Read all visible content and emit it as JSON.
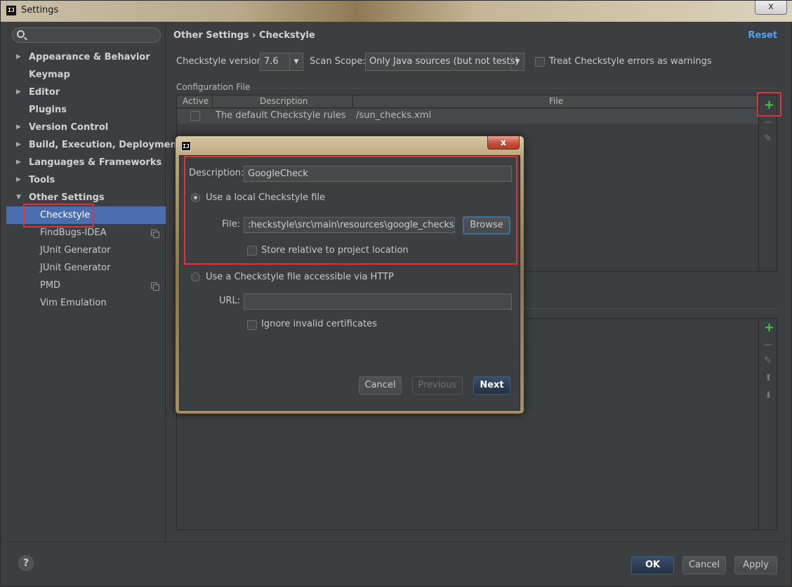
{
  "window": {
    "title": "Settings",
    "app_icon": "IJ",
    "close": "x"
  },
  "sidebar": {
    "search": {
      "placeholder": "",
      "value": ""
    },
    "items": [
      {
        "label": "Appearance & Behavior",
        "arrow": "▶"
      },
      {
        "label": "Keymap",
        "arrow": ""
      },
      {
        "label": "Editor",
        "arrow": "▶"
      },
      {
        "label": "Plugins",
        "arrow": ""
      },
      {
        "label": "Version Control",
        "arrow": "▶"
      },
      {
        "label": "Build, Execution, Deployment",
        "arrow": "▶"
      },
      {
        "label": "Languages & Frameworks",
        "arrow": "▶"
      },
      {
        "label": "Tools",
        "arrow": "▶"
      },
      {
        "label": "Other Settings",
        "arrow": "▼"
      }
    ],
    "children": [
      {
        "label": "Checkstyle",
        "selected": true
      },
      {
        "label": "FindBugs-IDEA",
        "copy_icon": true
      },
      {
        "label": "JUnit Generator"
      },
      {
        "label": "JUnit Generator"
      },
      {
        "label": "PMD",
        "copy_icon": true
      },
      {
        "label": "Vim Emulation"
      }
    ]
  },
  "main": {
    "breadcrumb": "Other Settings › Checkstyle",
    "reset": "Reset",
    "checkstyle_version_label": "Checkstyle version:",
    "checkstyle_version_value": "7.6",
    "scan_scope_label": "Scan Scope:",
    "scan_scope_value": "Only Java sources (but not tests)",
    "treat_errors_label": "Treat Checkstyle errors as warnings",
    "config_section": "Configuration File",
    "table": {
      "headers": [
        "Active",
        "Description",
        "File"
      ],
      "rows": [
        {
          "description": "The default Checkstyle rules",
          "file": "/sun_checks.xml"
        }
      ]
    }
  },
  "dialog": {
    "icon": "IJ",
    "close": "x",
    "description_label": "Description:",
    "description_value": "GoogleCheck",
    "local_radio_label": "Use a local Checkstyle file",
    "file_label": "File:",
    "file_value": ":heckstyle\\src\\main\\resources\\google_checks.xml",
    "browse": "Browse",
    "store_relative_label": "Store relative to project location",
    "http_radio_label": "Use a Checkstyle file accessible via HTTP",
    "url_label": "URL:",
    "url_value": "",
    "ignore_certs_label": "Ignore invalid certificates",
    "cancel": "Cancel",
    "previous": "Previous",
    "next": "Next"
  },
  "footer": {
    "help": "?",
    "ok": "OK",
    "cancel": "Cancel",
    "apply": "Apply"
  },
  "icons": {
    "add": "plus-icon",
    "remove": "minus-icon",
    "edit": "pencil-icon",
    "move_up": "arrow-up-icon",
    "move_down": "arrow-down-icon",
    "search": "search-icon",
    "help": "help-icon"
  },
  "colors": {
    "selection": "#4b6eaf",
    "link": "#589df6",
    "highlight_box": "#e0323e",
    "add_icon": "#4ec24e"
  }
}
